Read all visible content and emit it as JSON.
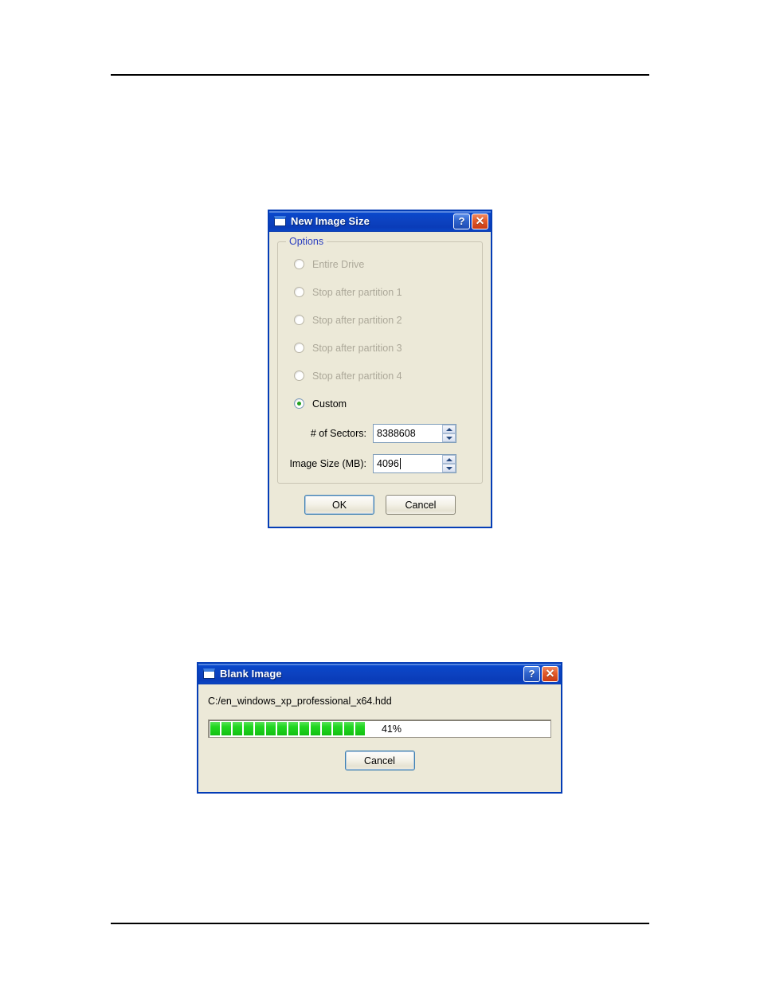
{
  "page": {
    "top_rule": true,
    "bottom_rule": true,
    "background_color": "#ffffff"
  },
  "theme": {
    "titlebar_blue": "#0A46C8",
    "dialog_face": "#ECE9D8",
    "group_label_blue": "#2B3FC0",
    "disabled_text": "#ACA899",
    "progress_green": "#22D722",
    "default_button_border": "#3C7FB1"
  },
  "dialog_new_image_size": {
    "title": "New Image Size",
    "window_icon": "window-icon",
    "titlebar_buttons": [
      {
        "name": "help-button",
        "glyph": "?"
      },
      {
        "name": "close-button",
        "glyph": "✕"
      }
    ],
    "group": {
      "title": "Options",
      "radios": [
        {
          "label": "Entire Drive",
          "checked": false,
          "disabled": true
        },
        {
          "label": "Stop after partition 1",
          "checked": false,
          "disabled": true
        },
        {
          "label": "Stop after partition 2",
          "checked": false,
          "disabled": true
        },
        {
          "label": "Stop after partition 3",
          "checked": false,
          "disabled": true
        },
        {
          "label": "Stop after partition 4",
          "checked": false,
          "disabled": true
        },
        {
          "label": "Custom",
          "checked": true,
          "disabled": false
        }
      ],
      "fields": [
        {
          "label": "# of Sectors:",
          "value": "8388608",
          "focused": false
        },
        {
          "label": "Image Size (MB):",
          "value": "4096",
          "focused": true
        }
      ]
    },
    "buttons": [
      {
        "label": "OK",
        "default": true
      },
      {
        "label": "Cancel",
        "default": false
      }
    ]
  },
  "dialog_blank_image": {
    "title": "Blank Image",
    "window_icon": "window-icon",
    "titlebar_buttons": [
      {
        "name": "help-button",
        "glyph": "?"
      },
      {
        "name": "close-button",
        "glyph": "✕"
      }
    ],
    "path": "C:/en_windows_xp_professional_x64.hdd",
    "progress": {
      "percent_label": "41%",
      "percent": 41,
      "chunks_filled": 14
    },
    "buttons": [
      {
        "label": "Cancel",
        "default": true
      }
    ]
  }
}
